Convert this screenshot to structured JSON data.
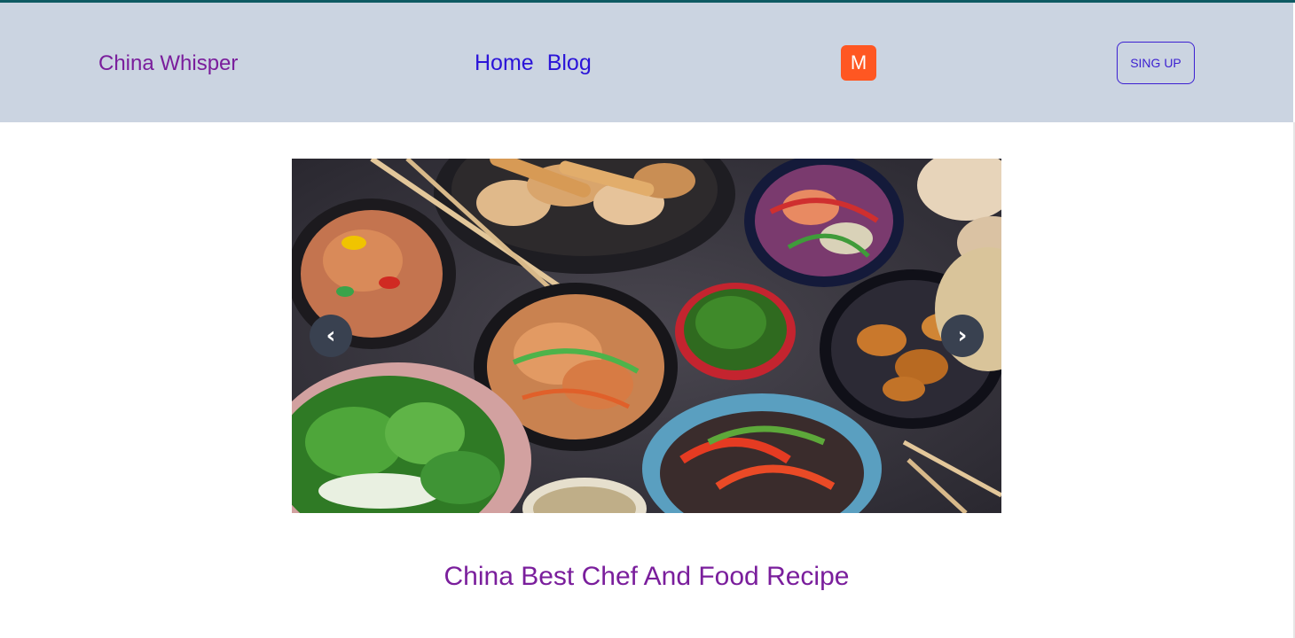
{
  "header": {
    "brand": "China Whisper",
    "nav": [
      "Home",
      "Blog"
    ],
    "avatar_letter": "M",
    "signup_label": "SING UP"
  },
  "carousel": {
    "prev_glyph": "‹",
    "next_glyph": "›"
  },
  "main": {
    "headline": "China Best Chef And Food Recipe"
  },
  "colors": {
    "top_rule": "#0e5a63",
    "nav_bg": "#cbd4e1",
    "brand_text": "#7a1e9c",
    "nav_link": "#2b14d8",
    "avatar_bg": "#ff5722",
    "signup_border": "#3b1fd1",
    "arrow_bg": "#394150"
  }
}
